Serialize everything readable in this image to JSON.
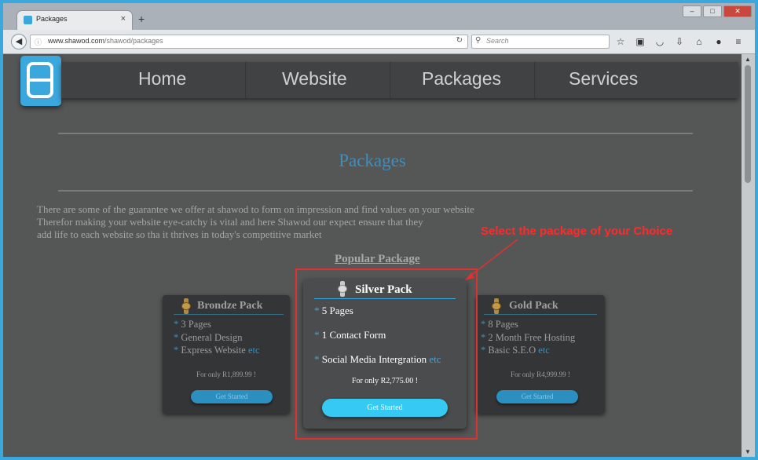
{
  "browser": {
    "tab_title": "Packages",
    "tab_close": "×",
    "new_tab": "+",
    "url_domain": "www.shawod.com",
    "url_path": "/shawod/packages",
    "search_placeholder": "Search"
  },
  "site": {
    "nav": [
      "Home",
      "Website",
      "Packages",
      "Services"
    ],
    "page_title": "Packages",
    "intro_lines": [
      "There are some of the guarantee we offer at shawod to form on impression and find values on your website",
      "Therefor making your website eye-catchy is vital and here Shawod our expect ensure that they",
      "add life to each website so tha it thrives in today's competitive market"
    ],
    "popular_heading": "Popular Package"
  },
  "packages": {
    "bronze": {
      "title": "Brondze Pack",
      "features": [
        "3 Pages",
        "General Design",
        "Express Website"
      ],
      "etc": "etc",
      "price": "For only R1,899.99 !",
      "button": "Get Started"
    },
    "silver": {
      "title": "Silver Pack",
      "features": [
        "5 Pages",
        "1 Contact Form",
        "Social Media Intergration"
      ],
      "etc": "etc",
      "price": "For only R2,775.00 !",
      "button": "Get Started"
    },
    "gold": {
      "title": "Gold Pack",
      "features": [
        "8 Pages",
        "2 Month Free Hosting",
        "Basic S.E.O"
      ],
      "etc": "etc",
      "price": "For only R4,999.99 !",
      "button": "Get Started"
    }
  },
  "annotation": {
    "callout": "Select the package of your Choice",
    "color": "#e03030"
  }
}
